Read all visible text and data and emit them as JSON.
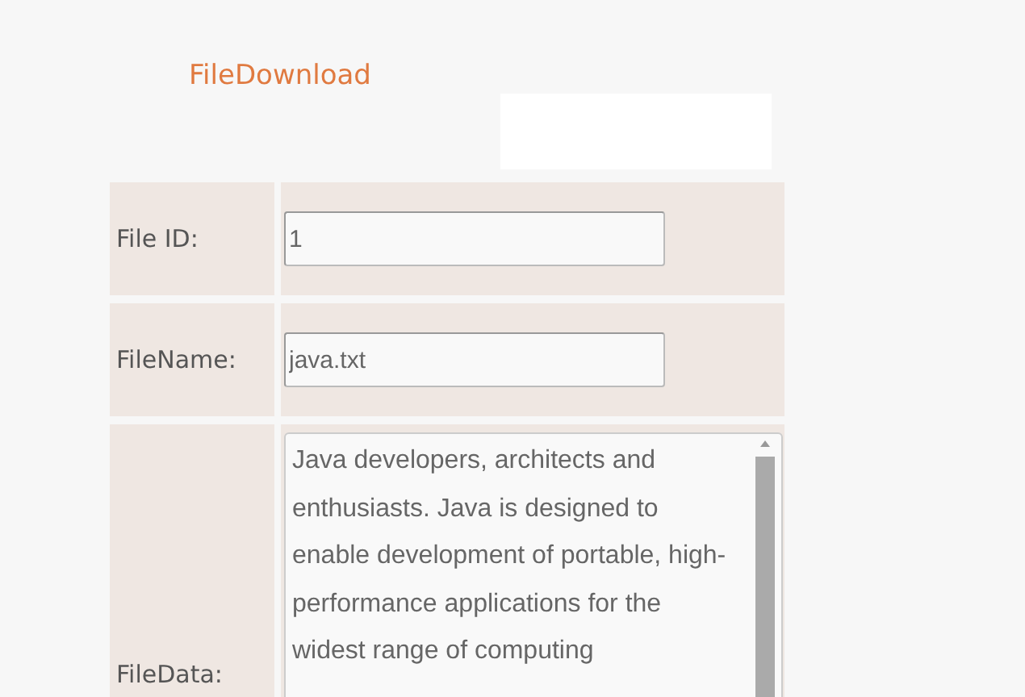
{
  "title": "FileDownload",
  "fields": [
    {
      "kind": "input",
      "label": "File ID:",
      "value": "1"
    },
    {
      "kind": "input",
      "label": "FileName:",
      "value": "java.txt"
    },
    {
      "kind": "textarea",
      "label": "FileData:",
      "value": "Java developers, architects and enthusiasts. Java is designed to enable development of portable, high-performance applications for the widest range of computing"
    }
  ]
}
